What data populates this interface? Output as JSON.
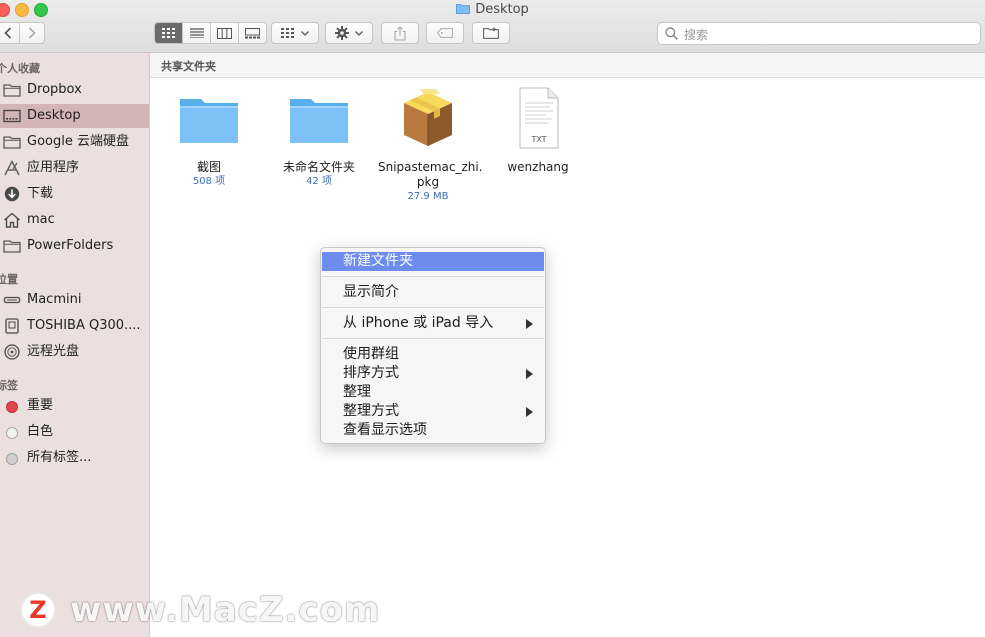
{
  "window": {
    "title": "Desktop"
  },
  "search": {
    "placeholder": "搜索"
  },
  "sidebar": {
    "favorites_header": "个人收藏",
    "favorites": [
      {
        "label": "Dropbox",
        "icon": "folder-icon"
      },
      {
        "label": "Desktop",
        "icon": "desktop-icon",
        "selected": true
      },
      {
        "label": "Google 云端硬盘",
        "icon": "folder-icon"
      },
      {
        "label": "应用程序",
        "icon": "applications-icon"
      },
      {
        "label": "下载",
        "icon": "download-icon"
      },
      {
        "label": "mac",
        "icon": "home-icon"
      },
      {
        "label": "PowerFolders",
        "icon": "folder-icon"
      }
    ],
    "locations_header": "位置",
    "locations": [
      {
        "label": "Macmini",
        "icon": "computer-icon"
      },
      {
        "label": "TOSHIBA Q300....",
        "icon": "disk-icon"
      },
      {
        "label": "远程光盘",
        "icon": "optical-disc-icon"
      }
    ],
    "tags_header": "标签",
    "tags": [
      {
        "label": "重要",
        "color": "#e0454a"
      },
      {
        "label": "白色",
        "color": "#f2f2f2"
      },
      {
        "label": "所有标签...",
        "color": "#cfcfcf"
      }
    ]
  },
  "path_bar": {
    "label": "共享文件夹"
  },
  "files": [
    {
      "name": "截图",
      "meta": "508 项",
      "icon": "folder-icon"
    },
    {
      "name": "未命名文件夹",
      "meta": "42 项",
      "icon": "folder-icon"
    },
    {
      "name": "Snipastemac_zhi.pkg",
      "name_line1": "Snipastemac_zhi.",
      "name_line2": "pkg",
      "meta": "27.9 MB",
      "icon": "package-icon"
    },
    {
      "name": "wenzhang",
      "meta": "",
      "icon": "txt-file-icon",
      "badge": "TXT"
    }
  ],
  "context_menu": {
    "items": [
      {
        "label": "新建文件夹",
        "highlighted": true
      },
      {
        "label": "显示简介"
      },
      {
        "label": "从 iPhone 或 iPad 导入",
        "submenu": true
      },
      {
        "label": "使用群组"
      },
      {
        "label": "排序方式",
        "submenu": true
      },
      {
        "label": "整理"
      },
      {
        "label": "整理方式",
        "submenu": true
      },
      {
        "label": "查看显示选项"
      }
    ]
  },
  "watermark": {
    "text": "www.MacZ.com",
    "badge": "Z"
  },
  "colors": {
    "sidebar_bg": "#ecdfdf",
    "sidebar_selected": "#d4b5b5",
    "menu_highlight": "#6c8ded",
    "folder_blue": "#6ab8f2"
  }
}
